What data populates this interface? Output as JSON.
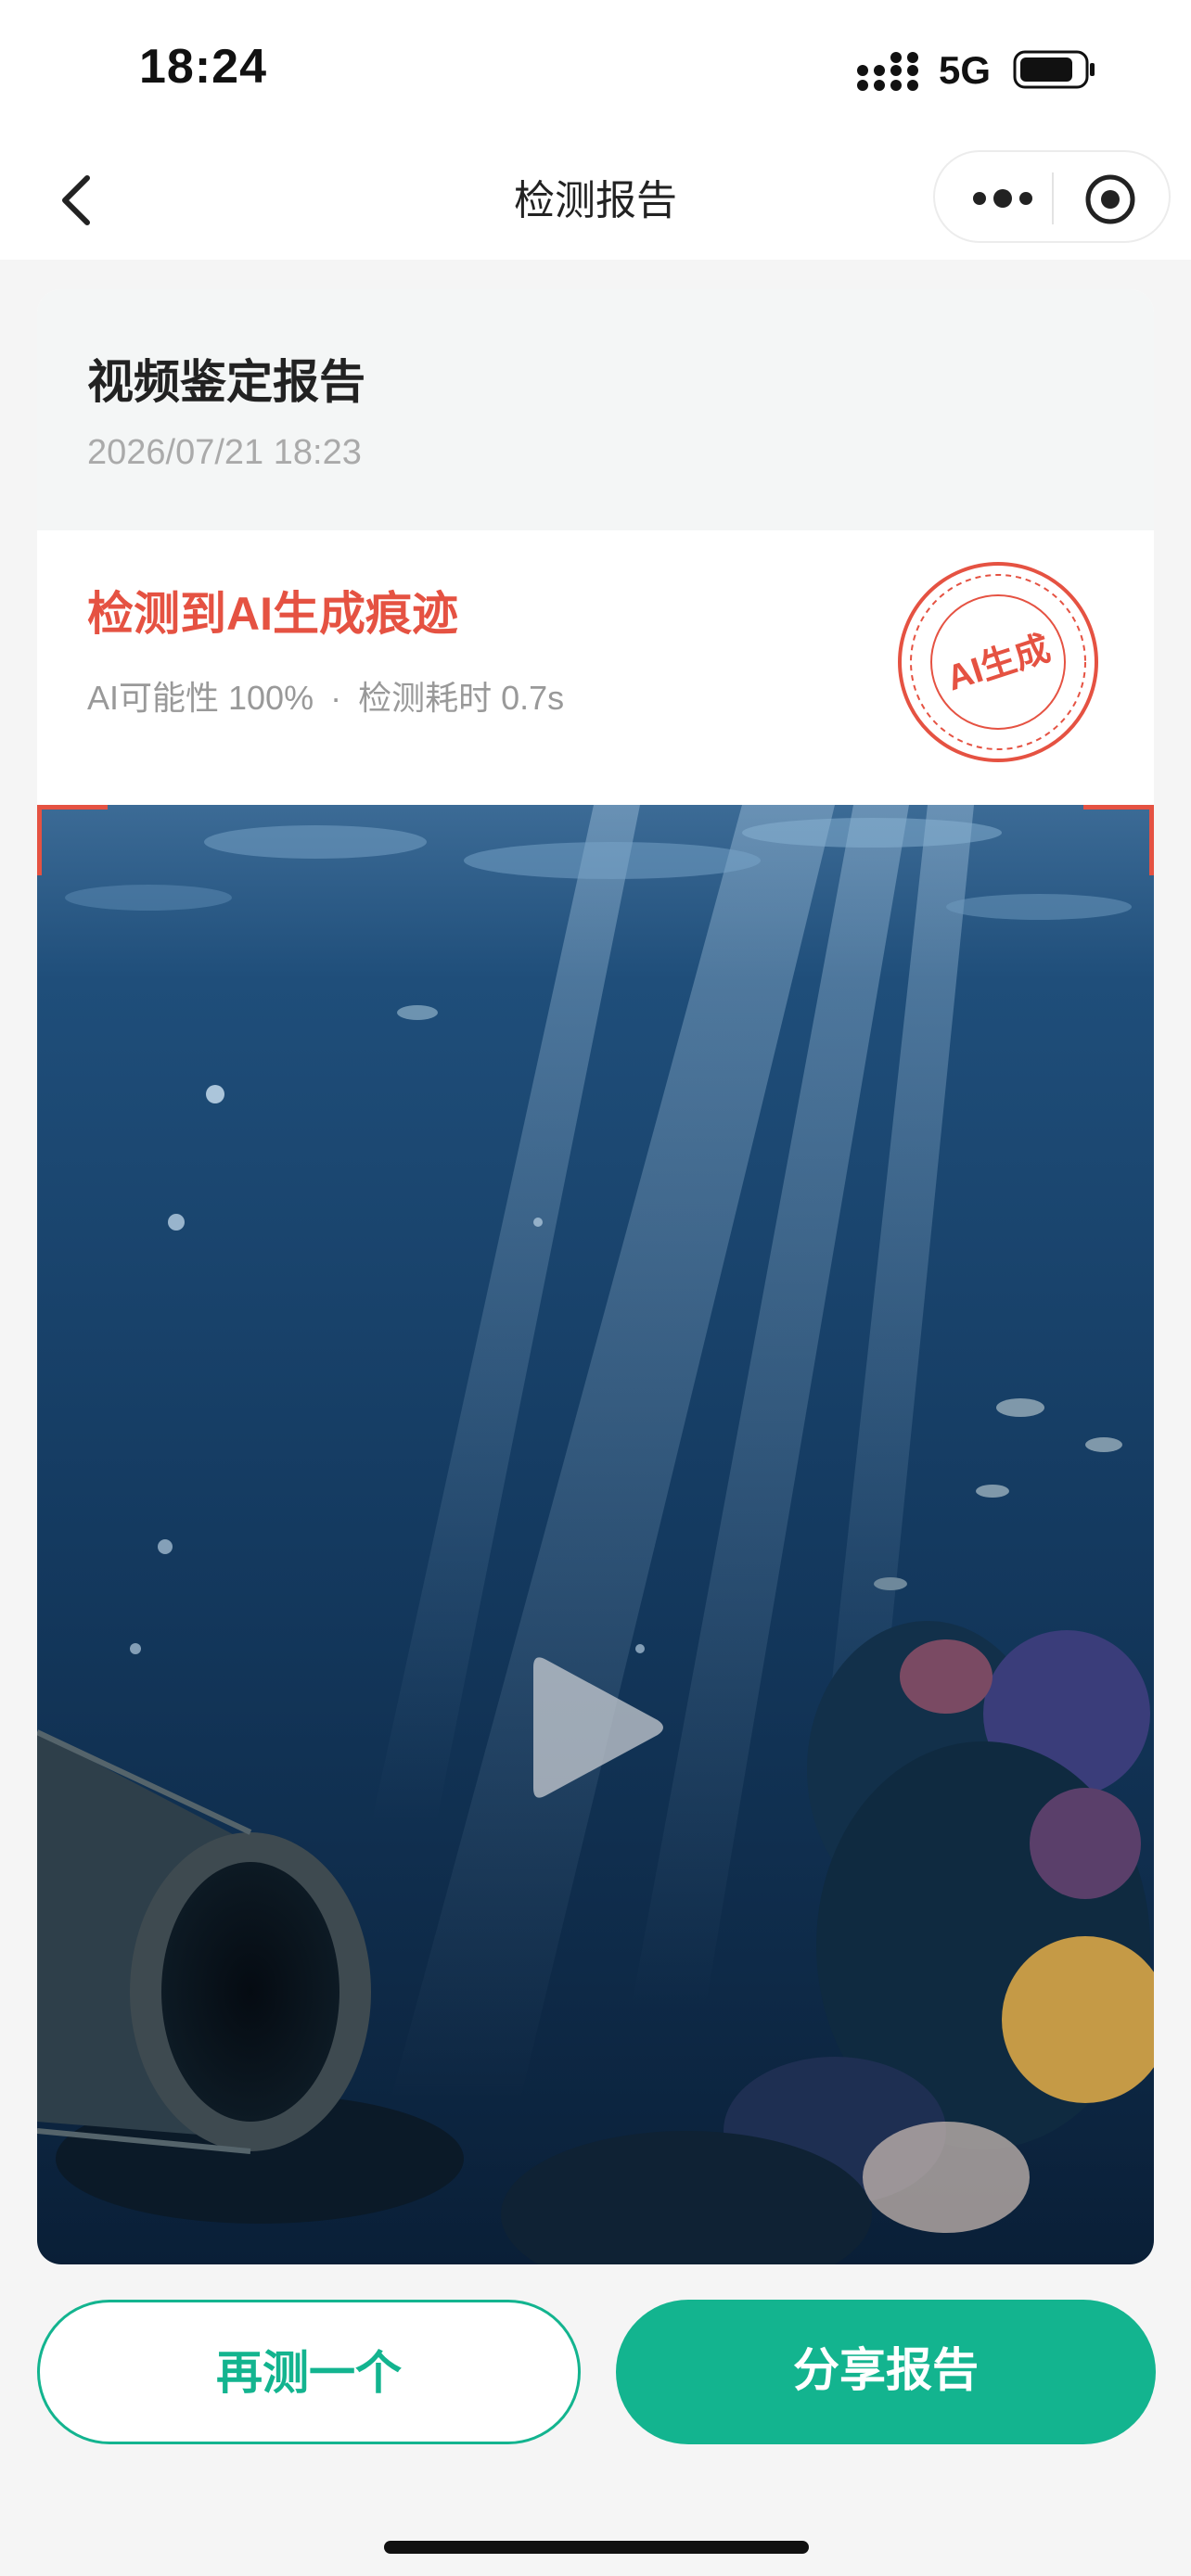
{
  "status": {
    "time": "18:24",
    "network": "5G"
  },
  "nav": {
    "title": "检测报告"
  },
  "report": {
    "title": "视频鉴定报告",
    "date": "2026/07/21 18:23",
    "result": "检测到AI生成痕迹",
    "probability": "AI可能性 100%",
    "separator": "·",
    "duration": "检测耗时 0.7s",
    "stamp_text": "AI生成"
  },
  "actions": {
    "again_label": "再测一个",
    "share_label": "分享报告"
  },
  "colors": {
    "accent_green": "#13b48f",
    "alert_red": "#e55242"
  },
  "icons": [
    "back-icon",
    "more-icon",
    "target-icon",
    "signal-icon",
    "battery-icon",
    "play-icon"
  ]
}
